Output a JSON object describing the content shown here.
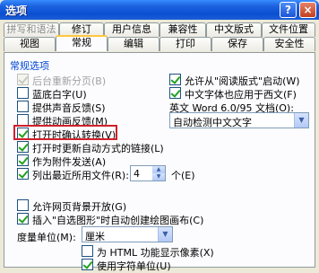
{
  "window": {
    "title": "选项",
    "help_label": "?",
    "close_label": "×"
  },
  "tabs_row1": [
    "拼写和语法",
    "修订",
    "用户信息",
    "兼容性",
    "中文版式",
    "文件位置"
  ],
  "tabs_row2": [
    "视图",
    "常规",
    "编辑",
    "打印",
    "保存",
    "安全性"
  ],
  "active_tab": "常规",
  "section": {
    "title": "常规选项"
  },
  "options": {
    "background_repaginate": {
      "label": "后台重新分页(B)",
      "checked": true,
      "disabled": true
    },
    "blue_background": {
      "label": "蓝底白字(U)",
      "checked": false
    },
    "sound_feedback": {
      "label": "提供声音反馈(S)",
      "checked": false
    },
    "animation_feedback": {
      "label": "提供动画反馈(M)",
      "checked": false
    },
    "confirm_conversion": {
      "label": "打开时确认转换(V)",
      "checked": true
    },
    "update_links": {
      "label": "打开时更新自动方式的链接(L)",
      "checked": true
    },
    "send_as_attachment": {
      "label": "作为附件发送(A)",
      "checked": true
    },
    "recent_files": {
      "label": "列出最近所用文件(R):",
      "checked": true,
      "count": "4",
      "unit": "个(E)"
    },
    "reading_layout": {
      "label": "允许从\"阅读版式\"启动(W)",
      "checked": true
    },
    "western_font": {
      "label": "中文字体也应用于西文(F)",
      "checked": true
    },
    "web_background": {
      "label": "允许网页背景开放(G)",
      "checked": false
    },
    "drawing_canvas": {
      "label": "插入\"自选图形\"时自动创建绘图画布(C)",
      "checked": true
    },
    "html_pixels": {
      "label": "为 HTML 功能显示像素(X)",
      "checked": false
    },
    "char_units": {
      "label": "使用字符单位(U)",
      "checked": true
    }
  },
  "word6": {
    "label": "英文 Word 6.0/95 文档(O):",
    "value": "自动检测中文文字"
  },
  "measure": {
    "label": "度量单位(M):",
    "value": "厘米"
  },
  "icons": {
    "dropdown": "▼",
    "spin_up": "▲",
    "spin_down": "▼"
  },
  "colors": {
    "titlebar": "#0a4fd0",
    "section_title": "#0046d5",
    "highlight_box": "#d0202a"
  }
}
